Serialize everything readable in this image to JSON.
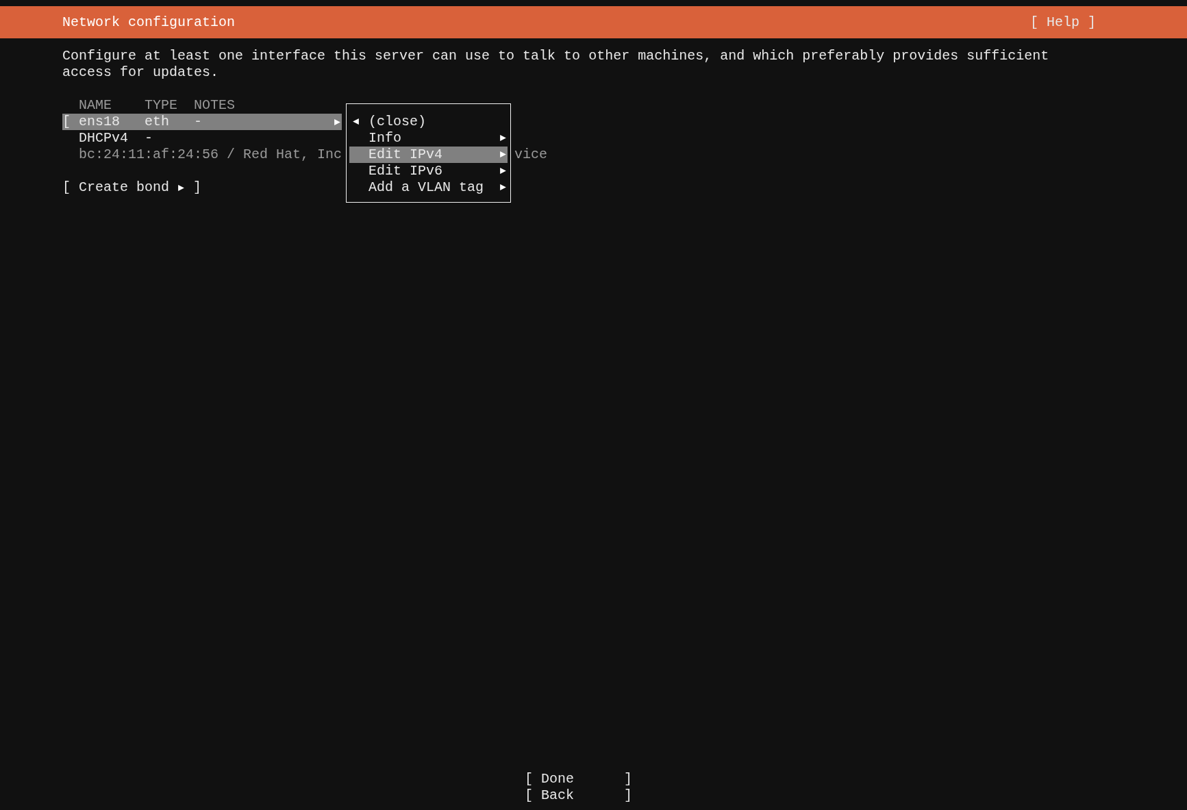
{
  "header": {
    "title": "Network configuration",
    "help_button": "[ Help ]"
  },
  "description": "Configure at least one interface this server can use to talk to other machines, and which preferably provides sufficient access for updates.",
  "table": {
    "columns": [
      "NAME",
      "TYPE",
      "NOTES"
    ],
    "device": {
      "bracket": "[",
      "name": "ens18",
      "type": "eth",
      "notes": "-",
      "selected": true,
      "submenu": true
    },
    "address_rows": [
      {
        "name": "DHCPv4",
        "value": "-"
      }
    ],
    "info_line": [
      "bc:24:11:af:24:56 / Red Hat, Inc",
      "vice"
    ]
  },
  "create_bond": {
    "bracket_open": "[",
    "label": "Create bond",
    "bracket_close": "]",
    "submenu": true
  },
  "menu": {
    "items": [
      {
        "label": "(close)",
        "kind": "back",
        "selected": false
      },
      {
        "label": "Info",
        "kind": "submenu",
        "selected": false
      },
      {
        "label": "Edit IPv4",
        "kind": "submenu",
        "selected": true
      },
      {
        "label": "Edit IPv6",
        "kind": "submenu",
        "selected": false
      },
      {
        "label": "Add a VLAN tag",
        "kind": "submenu",
        "selected": false
      }
    ]
  },
  "buttons": [
    {
      "bracket_open": "[",
      "label": "Done",
      "bracket_close": "]"
    },
    {
      "bracket_open": "[",
      "label": "Back",
      "bracket_close": "]"
    }
  ]
}
